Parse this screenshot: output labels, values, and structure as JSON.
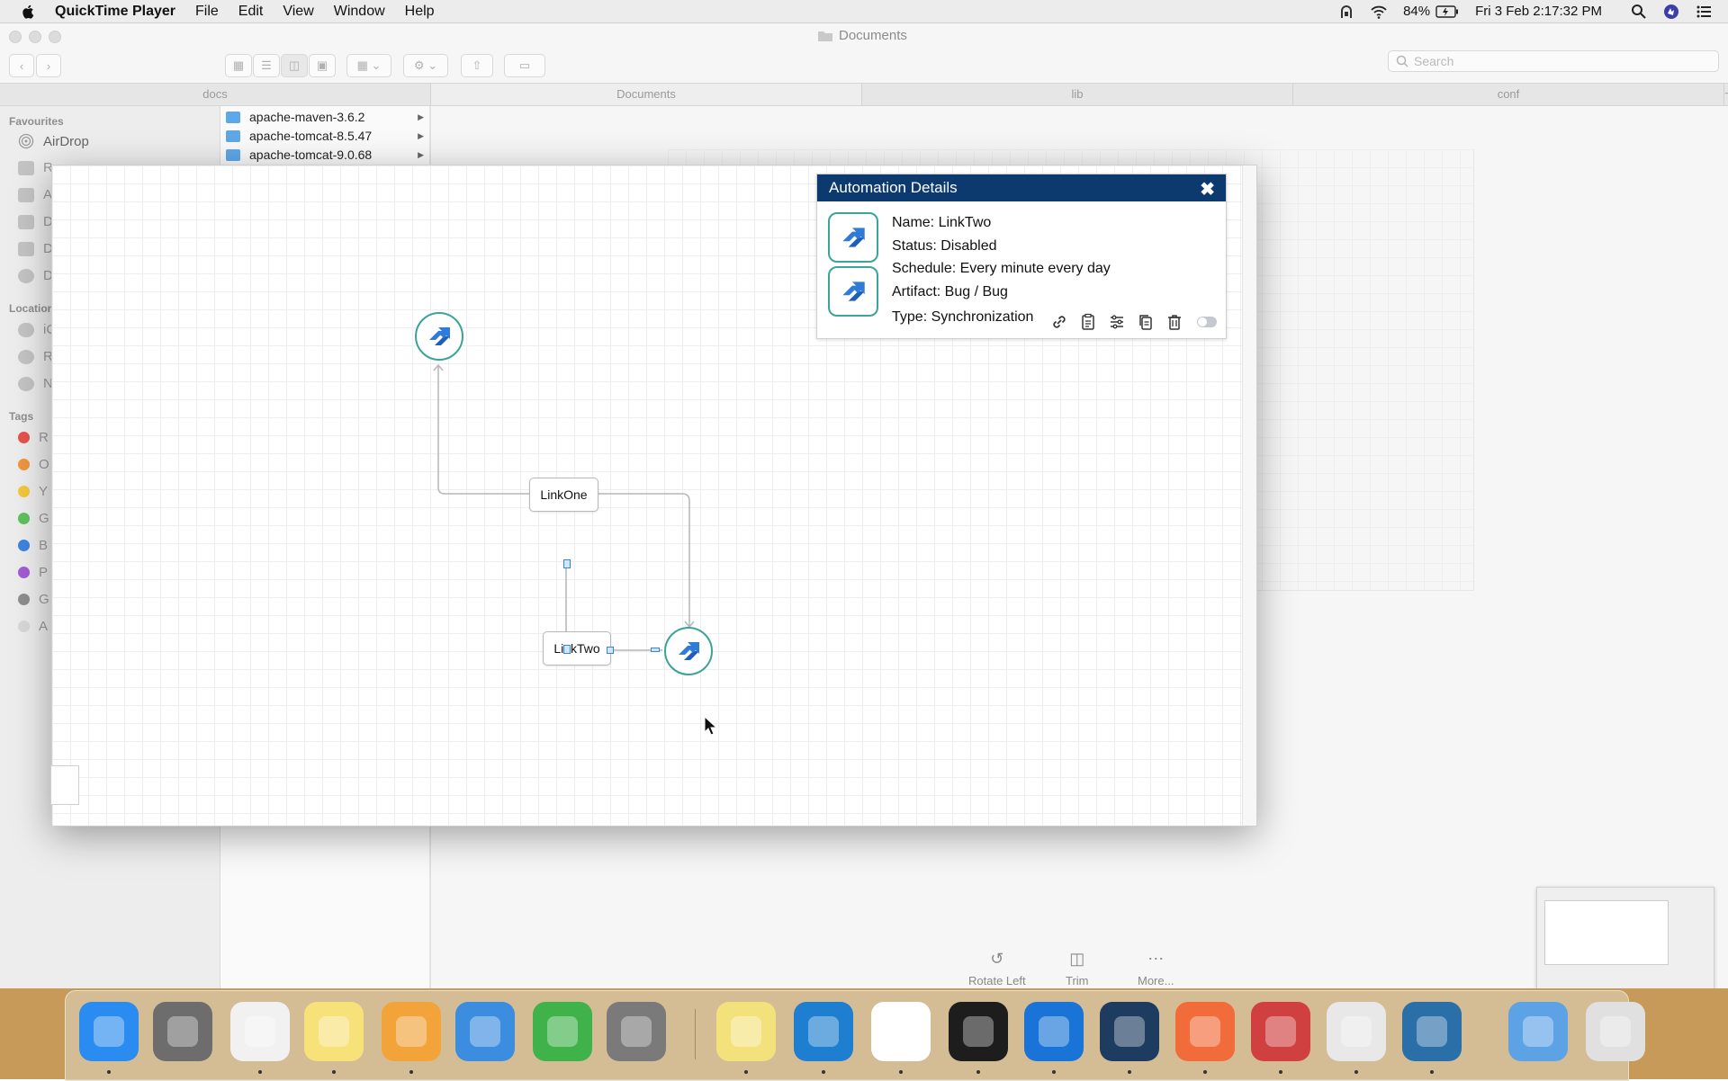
{
  "menubar": {
    "app_name": "QuickTime Player",
    "menus": [
      "File",
      "Edit",
      "View",
      "Window",
      "Help"
    ],
    "battery": "84%",
    "datetime": "Fri 3 Feb  2:17:32 PM"
  },
  "finder": {
    "window_title": "Documents",
    "search_placeholder": "Search",
    "tabs": [
      "docs",
      "Documents",
      "lib",
      "conf"
    ],
    "sidebar": {
      "favourites_label": "Favourites",
      "airdrop_label": "AirDrop",
      "favourite_initials": [
        "R",
        "A",
        "D",
        "D",
        "D"
      ],
      "locations_label": "Locations",
      "location_initials": [
        "iC",
        "R",
        "N"
      ],
      "tags_label": "Tags",
      "tags": [
        {
          "initial": "R",
          "color": "#e5534b"
        },
        {
          "initial": "O",
          "color": "#f0963c"
        },
        {
          "initial": "Y",
          "color": "#f3c73c"
        },
        {
          "initial": "G",
          "color": "#5ec25b"
        },
        {
          "initial": "B",
          "color": "#3d84e0"
        },
        {
          "initial": "P",
          "color": "#a45cd4"
        },
        {
          "initial": "G",
          "color": "#8e8e8e"
        },
        {
          "initial": "A",
          "color": "#d8d8d8"
        }
      ]
    },
    "column_items": [
      "apache-maven-3.6.2",
      "apache-tomcat-8.5.47",
      "apache-tomcat-9.0.68"
    ]
  },
  "canvas": {
    "links": [
      "LinkOne",
      "LinkTwo"
    ]
  },
  "details": {
    "title": "Automation Details",
    "name_line": "Name:  LinkTwo",
    "status_line": "Status: Disabled",
    "schedule_line": "Schedule: Every minute every day",
    "artifact_line": "Artifact: Bug / Bug",
    "type_line": "Type: Synchronization",
    "enabled": false
  },
  "quicktime": {
    "rotate_label": "Rotate Left",
    "trim_label": "Trim",
    "more_label": "More..."
  },
  "dock": {
    "apps": [
      {
        "name": "finder",
        "color": "#2a8cf0",
        "running": true
      },
      {
        "name": "launchpad",
        "color": "#6d6d6d",
        "running": false
      },
      {
        "name": "chrome",
        "color": "#f1f1f1",
        "running": true
      },
      {
        "name": "notes",
        "color": "#f7e27a",
        "running": true
      },
      {
        "name": "pages",
        "color": "#f2a33a",
        "running": true
      },
      {
        "name": "keynote",
        "color": "#3c8ce0",
        "running": false
      },
      {
        "name": "numbers",
        "color": "#3fb24a",
        "running": false
      },
      {
        "name": "system-preferences",
        "color": "#7a7a7a",
        "running": false
      },
      {
        "name": "stickies",
        "color": "#f3e27c",
        "running": true
      },
      {
        "name": "vscode",
        "color": "#1e7ecf",
        "running": true
      },
      {
        "name": "slack",
        "color": "#ffffff",
        "running": true
      },
      {
        "name": "terminal",
        "color": "#1d1d1d",
        "running": true
      },
      {
        "name": "onepassword",
        "color": "#1a73d6",
        "running": true
      },
      {
        "name": "mysql-workbench",
        "color": "#1d3c60",
        "running": true
      },
      {
        "name": "postman",
        "color": "#f26b3a",
        "running": true
      },
      {
        "name": "vlc-backup",
        "color": "#d04040",
        "running": true
      },
      {
        "name": "java",
        "color": "#e8e8e8",
        "running": true
      },
      {
        "name": "quicktime",
        "color": "#2b6fa8",
        "running": true
      },
      {
        "name": "downloads",
        "color": "#5ea2e6",
        "running": false
      },
      {
        "name": "trash",
        "color": "#e0e0e0",
        "running": false
      }
    ]
  }
}
